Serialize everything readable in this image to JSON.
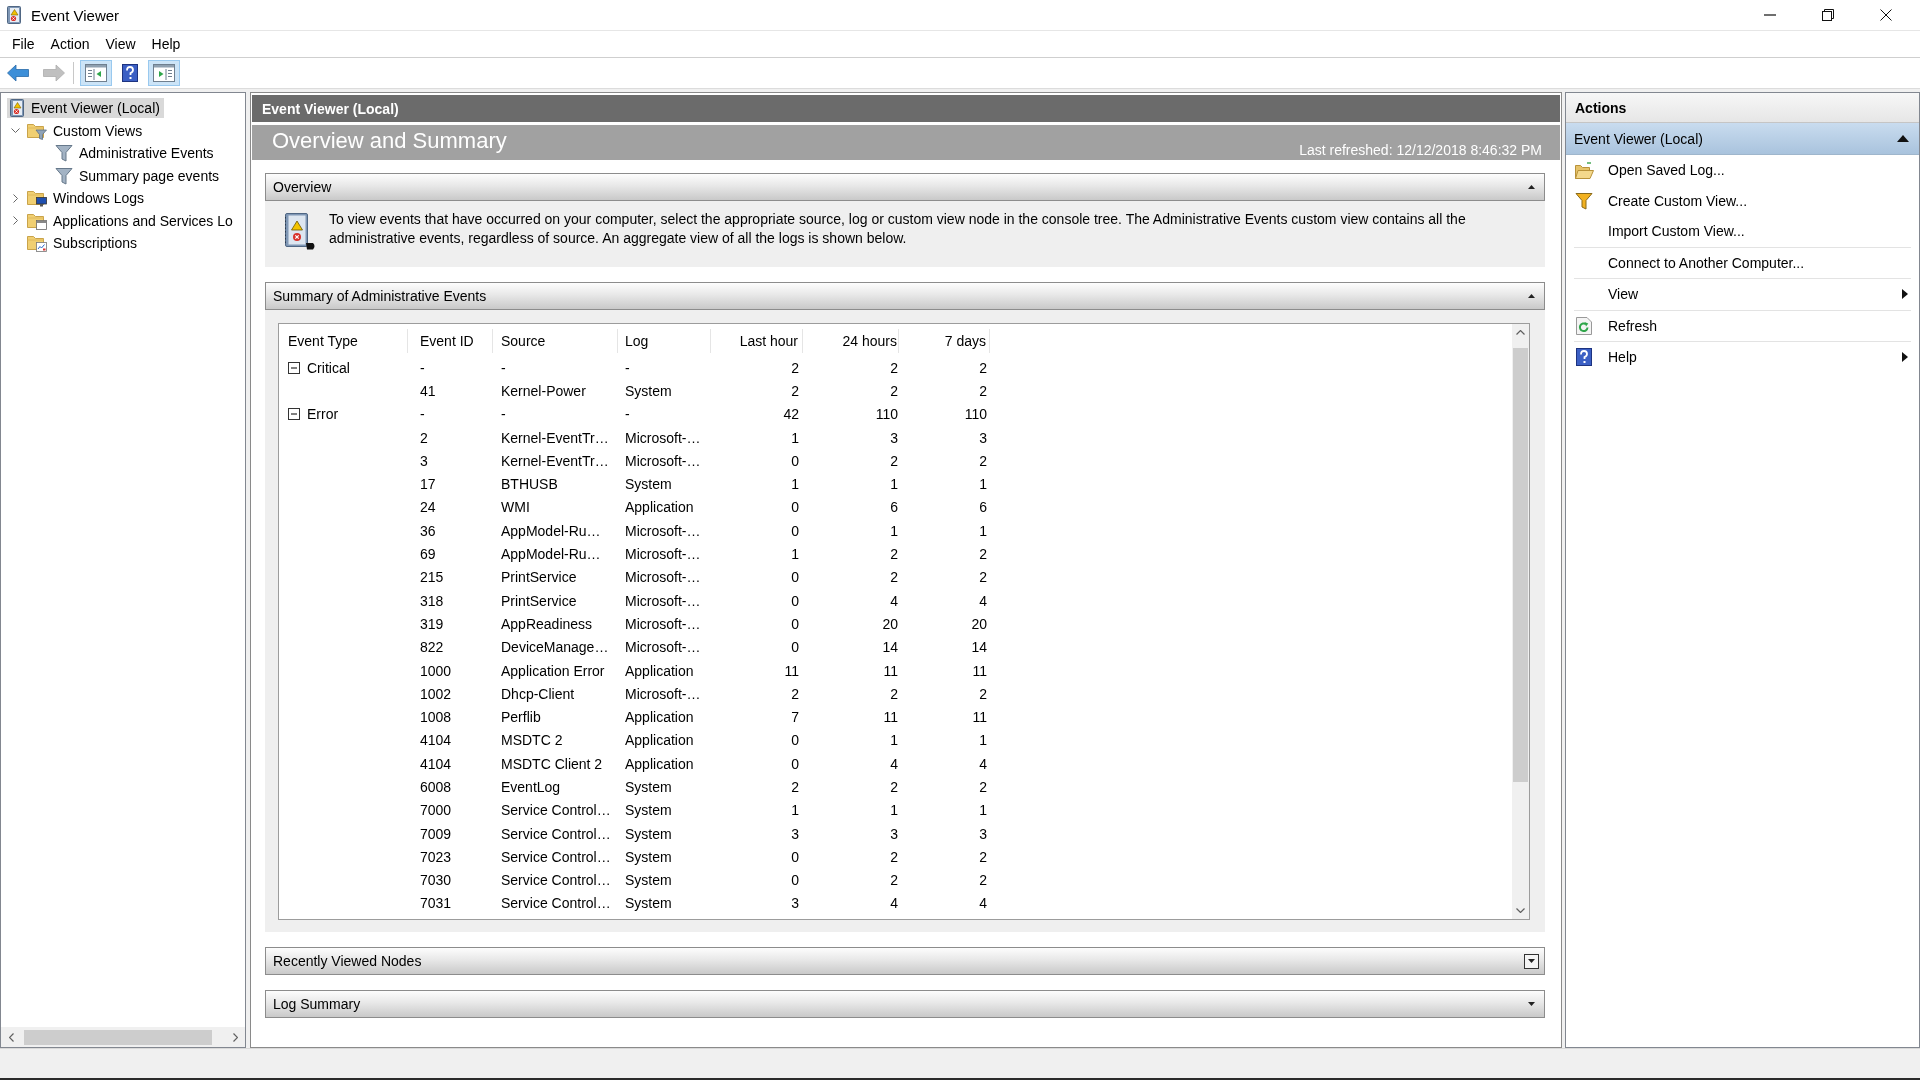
{
  "window": {
    "title": "Event Viewer"
  },
  "menu": [
    "File",
    "Action",
    "View",
    "Help"
  ],
  "toolbar": {
    "groups": [
      {
        "buttons": [
          {
            "kind": "back",
            "on": false,
            "disabled": false
          },
          {
            "kind": "forward",
            "on": false,
            "disabled": true
          }
        ]
      },
      {
        "buttons": [
          {
            "kind": "tree-pane",
            "on": true,
            "disabled": false
          },
          {
            "kind": "help",
            "on": false,
            "disabled": false
          },
          {
            "kind": "action-pane",
            "on": true,
            "disabled": false
          }
        ]
      }
    ]
  },
  "tree": [
    {
      "label": "Event Viewer (Local)",
      "kind": "root",
      "selected": true,
      "children": [
        {
          "label": "Custom Views",
          "kind": "custom-views",
          "selected": false,
          "expanded": true,
          "children": [
            {
              "label": "Administrative Events",
              "kind": "filter",
              "selected": false
            },
            {
              "label": "Summary page events",
              "kind": "filter",
              "selected": false
            }
          ]
        },
        {
          "label": "Windows Logs",
          "kind": "windows-logs",
          "selected": false,
          "expanded": false
        },
        {
          "label": "Applications and Services Lo",
          "kind": "app-logs",
          "selected": false,
          "expanded": false
        },
        {
          "label": "Subscriptions",
          "kind": "subscriptions",
          "selected": false
        }
      ]
    }
  ],
  "content": {
    "header": "Event Viewer (Local)",
    "title": "Overview and Summary",
    "last_refreshed": "Last refreshed: 12/12/2018 8:46:32 PM",
    "sections": [
      {
        "title": "Overview",
        "kind": "text",
        "expanded": true,
        "focused": false,
        "text": "To view events that have occurred on your computer, select the appropriate source, log or custom view node in the console tree. The Administrative Events custom view contains all the administrative events, regardless of source. An aggregate view of all the logs is shown below."
      },
      {
        "title": "Summary of Administrative Events",
        "kind": "table",
        "expanded": true,
        "focused": false,
        "table": {
          "columns": [
            {
              "label": "Event Type",
              "kind": "text"
            },
            {
              "label": "Event ID",
              "kind": "text"
            },
            {
              "label": "Source",
              "kind": "text"
            },
            {
              "label": "Log",
              "kind": "text"
            },
            {
              "label": "Last hour",
              "kind": "number"
            },
            {
              "label": "24 hours",
              "kind": "number"
            },
            {
              "label": "7 days",
              "kind": "number"
            }
          ],
          "rows": [
            {
              "expanded": true,
              "cells": [
                "Critical",
                "-",
                "-",
                "-",
                "2",
                "2",
                "2"
              ],
              "children": [
                {
                  "cells": [
                    "",
                    "41",
                    "Kernel-Power",
                    "System",
                    "2",
                    "2",
                    "2"
                  ]
                }
              ]
            },
            {
              "expanded": true,
              "cells": [
                "Error",
                "-",
                "-",
                "-",
                "42",
                "110",
                "110"
              ],
              "children": [
                {
                  "cells": [
                    "",
                    "2",
                    "Kernel-EventTr…",
                    "Microsoft-…",
                    "1",
                    "3",
                    "3"
                  ]
                },
                {
                  "cells": [
                    "",
                    "3",
                    "Kernel-EventTr…",
                    "Microsoft-…",
                    "0",
                    "2",
                    "2"
                  ]
                },
                {
                  "cells": [
                    "",
                    "17",
                    "BTHUSB",
                    "System",
                    "1",
                    "1",
                    "1"
                  ]
                },
                {
                  "cells": [
                    "",
                    "24",
                    "WMI",
                    "Application",
                    "0",
                    "6",
                    "6"
                  ]
                },
                {
                  "cells": [
                    "",
                    "36",
                    "AppModel-Ru…",
                    "Microsoft-…",
                    "0",
                    "1",
                    "1"
                  ]
                },
                {
                  "cells": [
                    "",
                    "69",
                    "AppModel-Ru…",
                    "Microsoft-…",
                    "1",
                    "2",
                    "2"
                  ]
                },
                {
                  "cells": [
                    "",
                    "215",
                    "PrintService",
                    "Microsoft-…",
                    "0",
                    "2",
                    "2"
                  ]
                },
                {
                  "cells": [
                    "",
                    "318",
                    "PrintService",
                    "Microsoft-…",
                    "0",
                    "4",
                    "4"
                  ]
                },
                {
                  "cells": [
                    "",
                    "319",
                    "AppReadiness",
                    "Microsoft-…",
                    "0",
                    "20",
                    "20"
                  ]
                },
                {
                  "cells": [
                    "",
                    "822",
                    "DeviceManage…",
                    "Microsoft-…",
                    "0",
                    "14",
                    "14"
                  ]
                },
                {
                  "cells": [
                    "",
                    "1000",
                    "Application Error",
                    "Application",
                    "11",
                    "11",
                    "11"
                  ]
                },
                {
                  "cells": [
                    "",
                    "1002",
                    "Dhcp-Client",
                    "Microsoft-…",
                    "2",
                    "2",
                    "2"
                  ]
                },
                {
                  "cells": [
                    "",
                    "1008",
                    "Perflib",
                    "Application",
                    "7",
                    "11",
                    "11"
                  ]
                },
                {
                  "cells": [
                    "",
                    "4104",
                    "MSDTC 2",
                    "Application",
                    "0",
                    "1",
                    "1"
                  ]
                },
                {
                  "cells": [
                    "",
                    "4104",
                    "MSDTC Client 2",
                    "Application",
                    "0",
                    "4",
                    "4"
                  ]
                },
                {
                  "cells": [
                    "",
                    "6008",
                    "EventLog",
                    "System",
                    "2",
                    "2",
                    "2"
                  ]
                },
                {
                  "cells": [
                    "",
                    "7000",
                    "Service Control…",
                    "System",
                    "1",
                    "1",
                    "1"
                  ]
                },
                {
                  "cells": [
                    "",
                    "7009",
                    "Service Control…",
                    "System",
                    "3",
                    "3",
                    "3"
                  ]
                },
                {
                  "cells": [
                    "",
                    "7023",
                    "Service Control…",
                    "System",
                    "0",
                    "2",
                    "2"
                  ]
                },
                {
                  "cells": [
                    "",
                    "7030",
                    "Service Control…",
                    "System",
                    "0",
                    "2",
                    "2"
                  ]
                },
                {
                  "cells": [
                    "",
                    "7031",
                    "Service Control…",
                    "System",
                    "3",
                    "4",
                    "4"
                  ]
                }
              ]
            }
          ]
        }
      },
      {
        "title": "Recently Viewed Nodes",
        "expanded": false,
        "focused": true
      },
      {
        "title": "Log Summary",
        "expanded": false,
        "focused": false
      }
    ]
  },
  "actions": {
    "title": "Actions",
    "sections": [
      {
        "label": "Event Viewer (Local)",
        "expanded": true,
        "groups": [
          {
            "items": [
              {
                "label": "Open Saved Log...",
                "kind": "open-log",
                "submenu": false
              },
              {
                "label": "Create Custom View...",
                "kind": "custom-view",
                "submenu": false
              },
              {
                "label": "Import Custom View...",
                "kind": "plain",
                "submenu": false
              }
            ]
          },
          {
            "items": [
              {
                "label": "Connect to Another Computer...",
                "kind": "plain",
                "submenu": false
              }
            ]
          },
          {
            "items": [
              {
                "label": "View",
                "kind": "plain",
                "submenu": true
              }
            ]
          },
          {
            "items": [
              {
                "label": "Refresh",
                "kind": "refresh",
                "submenu": false
              }
            ]
          },
          {
            "items": [
              {
                "label": "Help",
                "kind": "help",
                "submenu": true
              }
            ]
          }
        ]
      }
    ]
  }
}
